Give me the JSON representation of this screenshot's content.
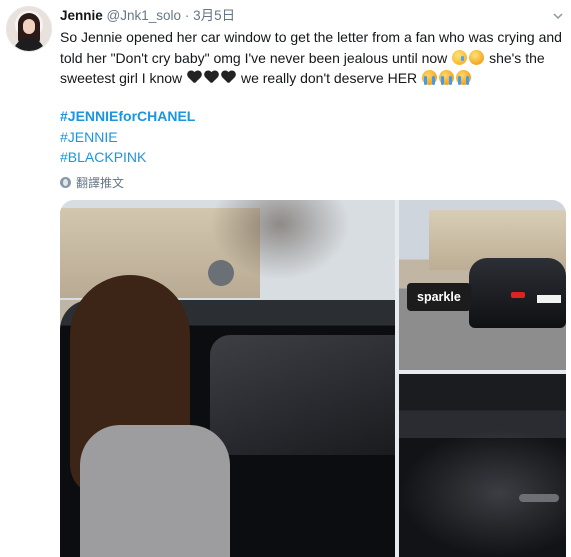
{
  "user": {
    "display_name": "Jennie",
    "handle": "@Jnk1_solo",
    "separator": "·",
    "date": "3月5日"
  },
  "tweet": {
    "line1": "So Jennie opened her car window to get the letter from a fan who was crying and",
    "line2_text": "told her \"Don't cry baby\" omg I've never been jealous until now",
    "line2_tail": "she's the",
    "line3_text": "sweetest girl I know",
    "line3_mid": "we really don't deserve HER",
    "hashtags": [
      "#JENNIEforCHANEL",
      "#JENNIE",
      "#BLACKPINK"
    ],
    "translate_label": "翻譯推文"
  },
  "media": {
    "sticker_label": "sparkle"
  },
  "icons": {
    "caret": "chevron-down-icon",
    "translate": "globe-icon",
    "emoji_sad": "sad-relieved-face-emoji",
    "emoji_confounded": "confounded-face-emoji",
    "emoji_cry": "loudly-crying-face-emoji",
    "heart": "black-heart-emoji"
  },
  "colors": {
    "link": "#1b95e0",
    "muted": "#657786",
    "text": "#14171a"
  }
}
